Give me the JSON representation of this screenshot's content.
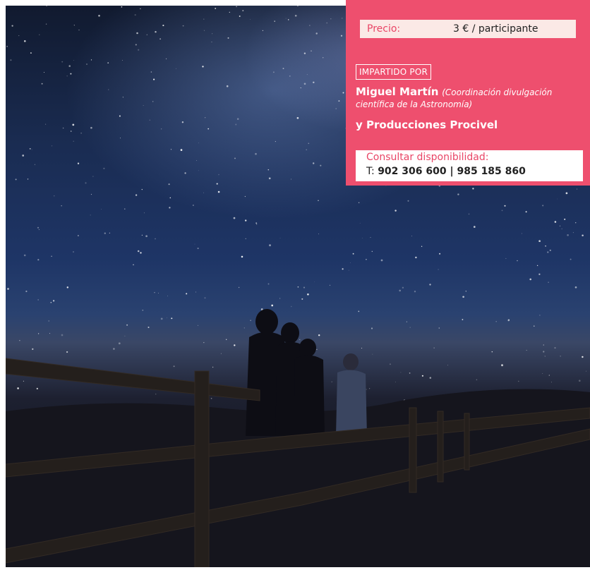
{
  "photo": {
    "description": "Personas observando el cielo estrellado junto a una valla de madera"
  },
  "panel": {
    "price_label": "Precio:",
    "price_value": "3 € / participante",
    "impartido_label": "IMPARTIDO POR",
    "instructor_name": "Miguel Martín",
    "instructor_role": "(Coordinación divulgación científica de la Astronomía)",
    "producer": "y Producciones Procivel",
    "contact_label": "Consultar disponibilidad:",
    "phone_prefix": "T:",
    "phone_numbers": "902 306 600 | 985 185 860"
  },
  "colors": {
    "panel_bg": "#ee4f6e",
    "price_bg": "#fbe9e6",
    "accent_text": "#e94566"
  }
}
